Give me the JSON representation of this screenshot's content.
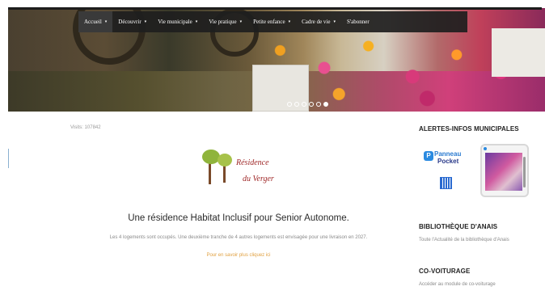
{
  "nav": {
    "items": [
      {
        "label": "Accueil",
        "caret": "▾",
        "active": true
      },
      {
        "label": "Découvrir",
        "caret": "▾"
      },
      {
        "label": "Vie municipale",
        "caret": "▾"
      },
      {
        "label": "Vie pratique",
        "caret": "▾"
      },
      {
        "label": "Petite enfance",
        "caret": "▾"
      },
      {
        "label": "Cadre de vie",
        "caret": "▾"
      },
      {
        "label": "S'abonner",
        "caret": ""
      }
    ]
  },
  "slider": {
    "dot_count": 6,
    "active_index": 5
  },
  "main": {
    "visits": "Visits: 107842",
    "logo": {
      "line1": "Résidence",
      "line2": "du Verger"
    },
    "headline": "Une résidence Habitat Inclusif pour Senior Autonome.",
    "paragraph": "Les 4 logements sont occupés. Une deuxième tranche de 4 autres logements est envisagée pour une livraison en 2027.",
    "link": "Pour en savoir plus cliquez ici"
  },
  "sidebar": {
    "alerts": {
      "title": "ALERTES-INFOS MUNICIPALES",
      "panneau_line1": "Panneau",
      "panneau_line2": "Pocket",
      "panneau_badge": "P"
    },
    "library": {
      "title": "BIBLIOTHÈQUE D'ANAIS",
      "text": "Toute l'Actualité de la bibliothèque d'Anais"
    },
    "carpool": {
      "title": "CO-VOITURAGE",
      "text": "Accéder au module de co-voiturage"
    }
  },
  "colors": {
    "link": "#e0a040",
    "nav_bg": "#1e1e1e",
    "accent_blue": "#2a8ae0"
  }
}
